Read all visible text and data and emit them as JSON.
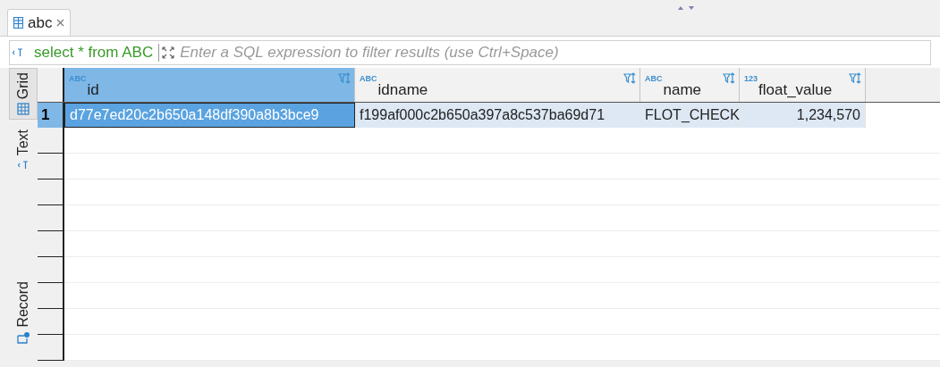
{
  "editor_tab": {
    "label": "abc",
    "selected": true
  },
  "filter": {
    "query": "select * from ABC",
    "placeholder": "Enter a SQL expression to filter results (use Ctrl+Space)"
  },
  "side_tabs": [
    {
      "label": "Grid",
      "kind": "grid",
      "selected": true
    },
    {
      "label": "Text",
      "kind": "text",
      "selected": false
    },
    {
      "label": "Record",
      "kind": "record",
      "selected": false
    }
  ],
  "table": {
    "columns": [
      {
        "type_label": "ABC",
        "name": "id",
        "selected": true
      },
      {
        "type_label": "ABC",
        "name": "idname",
        "selected": false
      },
      {
        "type_label": "ABC",
        "name": "name",
        "selected": false
      },
      {
        "type_label": "123",
        "name": "float_value",
        "selected": false
      }
    ],
    "rows": [
      {
        "number": "1",
        "selected": true,
        "cells": [
          {
            "text": "d77e7ed20c2b650a148df390a8b3bce9",
            "selected": true
          },
          {
            "text": "f199af000c2b650a397a8c537ba69d71",
            "selected": false
          },
          {
            "text": "FLOT_CHECK",
            "selected": false
          },
          {
            "text": "1,234,570",
            "selected": false
          }
        ]
      }
    ]
  }
}
